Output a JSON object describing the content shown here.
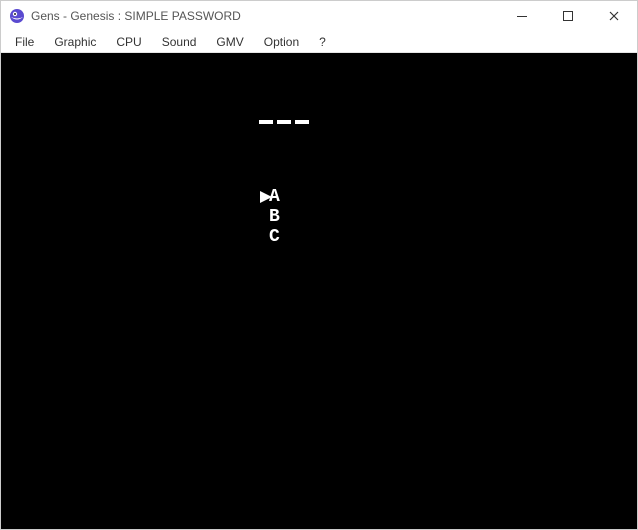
{
  "window": {
    "title": "Gens - Genesis : SIMPLE PASSWORD"
  },
  "menu": {
    "items": [
      "File",
      "Graphic",
      "CPU",
      "Sound",
      "GMV",
      "Option",
      "?"
    ]
  },
  "game": {
    "password_slot_count": 3,
    "cursor_index": 0,
    "options": [
      "A",
      "B",
      "C"
    ]
  }
}
